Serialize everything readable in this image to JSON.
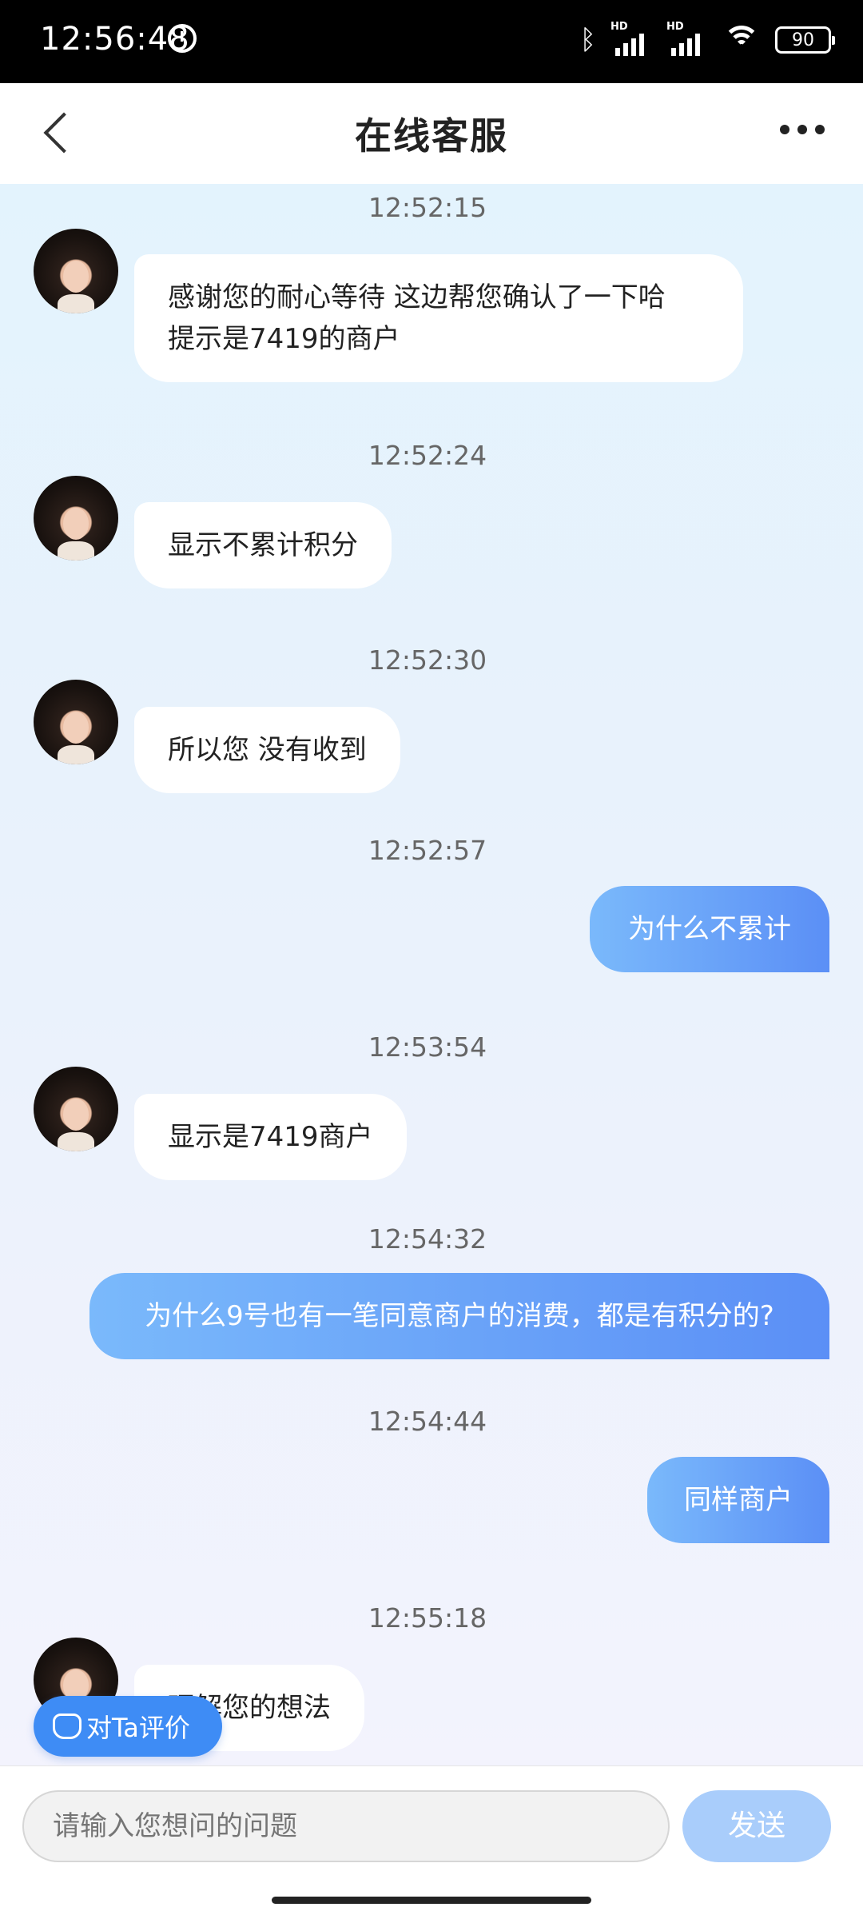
{
  "status": {
    "time": "12:56:48",
    "battery": "90",
    "hd": "HD"
  },
  "header": {
    "title": "在线客服"
  },
  "messages": [
    {
      "time": "12:52:15",
      "from": "agent",
      "lines": [
        "感谢您的耐心等待 这边帮您确认了一下哈",
        "提示是7419的商户"
      ]
    },
    {
      "time": "12:52:24",
      "from": "agent",
      "lines": [
        "显示不累计积分"
      ]
    },
    {
      "time": "12:52:30",
      "from": "agent",
      "lines": [
        "所以您 没有收到"
      ]
    },
    {
      "time": "12:52:57",
      "from": "user",
      "lines": [
        "为什么不累计"
      ]
    },
    {
      "time": "12:53:54",
      "from": "agent",
      "lines": [
        "显示是7419商户"
      ]
    },
    {
      "time": "12:54:32",
      "from": "user",
      "lines": [
        "为什么9号也有一笔同意商户的消费，都是有积分的?"
      ]
    },
    {
      "time": "12:54:44",
      "from": "user",
      "lines": [
        "同样商户"
      ]
    },
    {
      "time": "12:55:18",
      "from": "agent",
      "lines": [
        "理解您的想法"
      ]
    }
  ],
  "rate_button": {
    "label": "对Ta评价"
  },
  "composer": {
    "placeholder": "请输入您想问的问题",
    "send_label": "发送"
  }
}
